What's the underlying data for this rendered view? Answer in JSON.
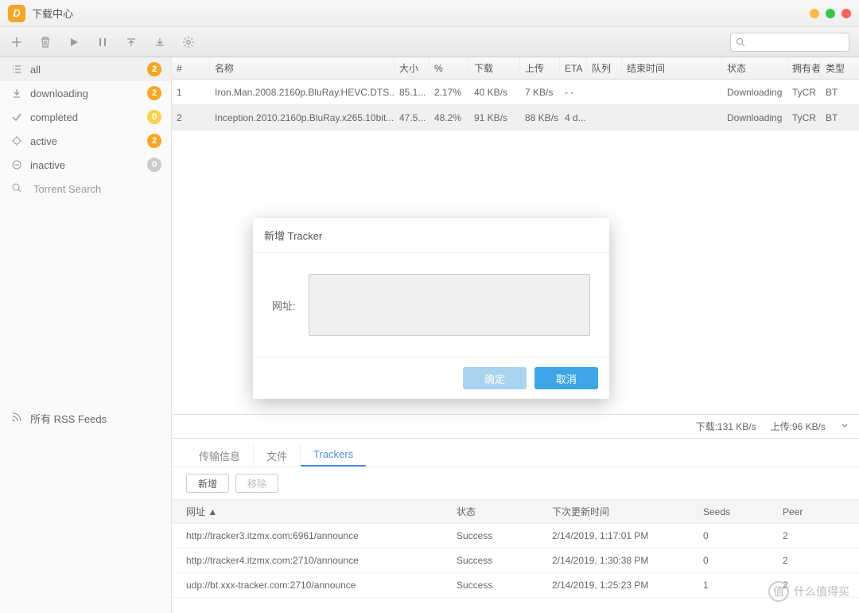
{
  "titlebar": {
    "app_initial": "D",
    "title": "下载中心"
  },
  "sidebar": {
    "items": [
      {
        "label": "all",
        "badge": "2",
        "badge_class": "o"
      },
      {
        "label": "downloading",
        "badge": "2",
        "badge_class": "o"
      },
      {
        "label": "completed",
        "badge": "0",
        "badge_class": "y"
      },
      {
        "label": "active",
        "badge": "2",
        "badge_class": "o"
      },
      {
        "label": "inactive",
        "badge": "0",
        "badge_class": "g"
      }
    ],
    "search_placeholder": "Torrent Search",
    "rss_label": "所有 RSS Feeds"
  },
  "columns": {
    "idx": "#",
    "name": "名称",
    "size": "大小",
    "pct": "%",
    "dl": "下载",
    "ul": "上传",
    "eta": "ETA",
    "queue": "队列",
    "end": "结束时间",
    "status": "状态",
    "owner": "拥有者",
    "type": "类型"
  },
  "rows": [
    {
      "idx": "1",
      "name": "Iron.Man.2008.2160p.BluRay.HEVC.DTS...",
      "size": "85.1...",
      "pct": "2.17%",
      "dl": "40 KB/s",
      "ul": "7 KB/s",
      "eta": "- -",
      "queue": "",
      "end": "",
      "status": "Downloading",
      "owner": "TyCR",
      "type": "BT"
    },
    {
      "idx": "2",
      "name": "Inception.2010.2160p.BluRay.x265.10bit....",
      "size": "47.5...",
      "pct": "48.2%",
      "dl": "91 KB/s",
      "ul": "88 KB/s",
      "eta": "4 d...",
      "queue": "",
      "end": "",
      "status": "Downloading",
      "owner": "TyCR",
      "type": "BT"
    }
  ],
  "stats": {
    "dl_label": "下载:",
    "dl_value": "131 KB/s",
    "ul_label": "上传:",
    "ul_value": "96 KB/s"
  },
  "detail": {
    "tabs": {
      "info": "传输信息",
      "files": "文件",
      "trackers": "Trackers"
    },
    "actions": {
      "add": "新增",
      "remove": "移除"
    },
    "head": {
      "url": "网址 ▲",
      "status": "状态",
      "next": "下次更新时间",
      "seeds": "Seeds",
      "peer": "Peer"
    },
    "trackers": [
      {
        "url": "http://tracker3.itzmx.com:6961/announce",
        "status": "Success",
        "time": "2/14/2019, 1:17:01 PM",
        "seeds": "0",
        "peer": "2"
      },
      {
        "url": "http://tracker4.itzmx.com:2710/announce",
        "status": "Success",
        "time": "2/14/2019, 1:30:38 PM",
        "seeds": "0",
        "peer": "2"
      },
      {
        "url": "udp://bt.xxx-tracker.com:2710/announce",
        "status": "Success",
        "time": "2/14/2019, 1:25:23 PM",
        "seeds": "1",
        "peer": "2"
      }
    ]
  },
  "dialog": {
    "title": "新增 Tracker",
    "url_label": "网址:",
    "ok": "确定",
    "cancel": "取消"
  },
  "watermark": {
    "icon": "值",
    "text": "什么值得买"
  }
}
